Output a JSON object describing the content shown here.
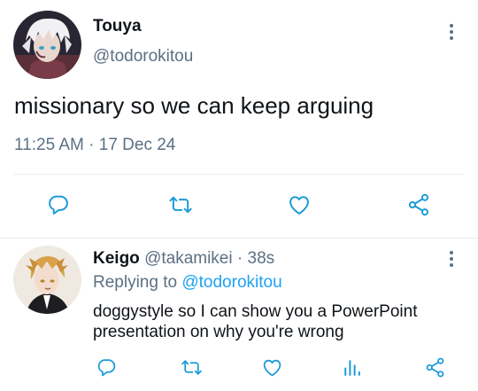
{
  "main_tweet": {
    "display_name": "Touya",
    "handle": "@todorokitou",
    "text": "missionary so we can keep arguing",
    "time": "11:25 AM",
    "separator": "·",
    "date": "17 Dec 24",
    "avatar_icon": "anime-avatar-white-hair",
    "more_icon": "more-vertical-icon"
  },
  "actions": {
    "reply_icon": "reply-icon",
    "retweet_icon": "retweet-icon",
    "like_icon": "heart-icon",
    "share_icon": "share-icon",
    "analytics_icon": "analytics-icon"
  },
  "reply_tweet": {
    "display_name": "Keigo",
    "handle": "@takamikei",
    "separator": "·",
    "age": "38s",
    "replying_to_label": "Replying to",
    "replying_to_handle": "@todorokitou",
    "text_line_1": "doggystyle so I can show you a PowerPoint",
    "text_line_2": "presentation on why you're wrong",
    "avatar_icon": "anime-avatar-blond-hair"
  },
  "colors": {
    "text_primary": "#0f1419",
    "text_secondary": "#5b7083",
    "accent": "#1da1f2",
    "icon": "#1c9bd8",
    "divider": "#e6ecf0"
  }
}
